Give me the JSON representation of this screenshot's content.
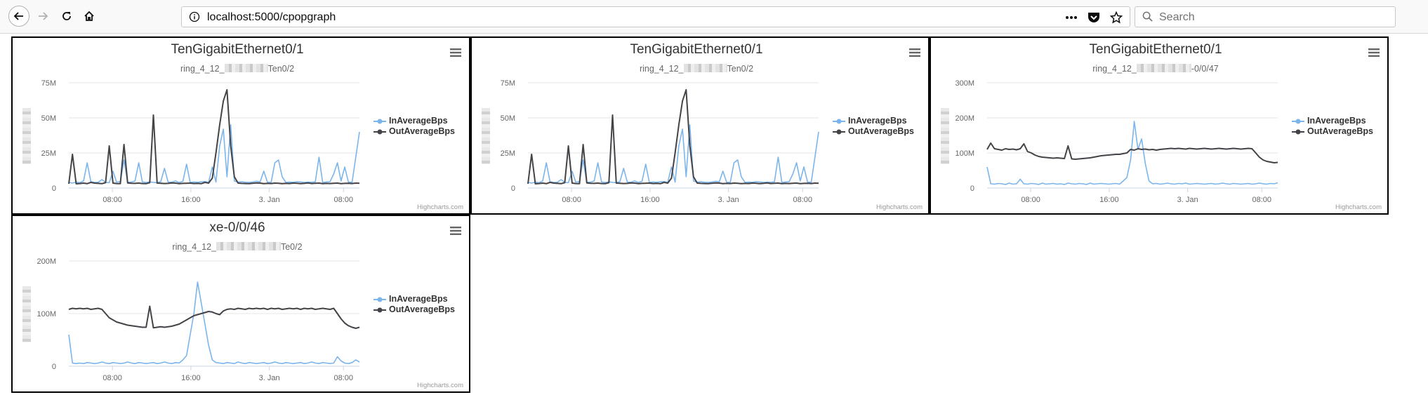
{
  "browser": {
    "url": "localhost:5000/cpopgraph",
    "search_placeholder": "Search"
  },
  "panels": [
    {
      "title": "TenGigabitEthernet0/1",
      "subtitle_left": "ring_4_12_",
      "subtitle_right": "Ten0/2",
      "credits": "Highcharts.com",
      "legend": [
        "InAverageBps",
        "OutAverageBps"
      ]
    },
    {
      "title": "TenGigabitEthernet0/1",
      "subtitle_left": "ring_4_12_",
      "subtitle_right": "Ten0/2",
      "credits": "Highcharts.com",
      "legend": [
        "InAverageBps",
        "OutAverageBps"
      ]
    },
    {
      "title": "TenGigabitEthernet0/1",
      "subtitle_left": "ring_4_12_",
      "subtitle_right": "-0/0/47",
      "credits": "Highcharts.com",
      "legend": [
        "InAverageBps",
        "OutAverageBps"
      ]
    },
    {
      "title": "xe-0/0/46",
      "subtitle_left": "ring_4_12_",
      "subtitle_right": "Te0/2",
      "credits": "Highcharts.com",
      "legend": [
        "InAverageBps",
        "OutAverageBps"
      ]
    }
  ],
  "chart_data": [
    {
      "type": "line",
      "title": "TenGigabitEthernet0/1",
      "subtitle": "ring_4_12_… Ten0/2",
      "x_ticks": [
        "08:00",
        "16:00",
        "3. Jan",
        "08:00"
      ],
      "y_ticks": [
        "0",
        "25M",
        "50M",
        "75M"
      ],
      "ylim": [
        0,
        75000000
      ],
      "legend_position": "right",
      "grid": true,
      "colors": {
        "InAverageBps": "#7cb5ec",
        "OutAverageBps": "#434348"
      },
      "series": [
        {
          "name": "InAverageBps",
          "values": [
            4000000,
            3500000,
            4200000,
            3800000,
            5000000,
            18000000,
            4500000,
            3900000,
            4100000,
            6000000,
            4000000,
            3800000,
            12000000,
            4200000,
            4500000,
            20000000,
            4100000,
            4200000,
            5000000,
            18000000,
            4300000,
            3900000,
            4400000,
            4000000,
            3800000,
            4600000,
            14000000,
            4200000,
            4100000,
            5000000,
            3900000,
            4800000,
            17000000,
            4000000,
            4300000,
            4100000,
            4400000,
            4600000,
            4000000,
            15000000,
            4200000,
            30000000,
            42000000,
            8000000,
            45000000,
            5000000,
            4200000,
            4500000,
            4100000,
            4000000,
            4300000,
            4800000,
            4400000,
            12000000,
            4100000,
            4000000,
            18000000,
            20000000,
            8000000,
            4000000,
            4200000,
            4100000,
            4500000,
            4300000,
            4000000,
            4200000,
            4100000,
            4400000,
            22000000,
            4000000,
            4300000,
            4500000,
            10000000,
            18000000,
            5000000,
            15000000,
            4200000,
            4100000,
            22000000,
            40000000
          ]
        },
        {
          "name": "OutAverageBps",
          "values": [
            3000000,
            24000000,
            3000000,
            3200000,
            3500000,
            3100000,
            4000000,
            3500000,
            3300000,
            3100000,
            3800000,
            30000000,
            3500000,
            3200000,
            3100000,
            31000000,
            3600000,
            3400000,
            3300000,
            3500000,
            3200000,
            3100000,
            3800000,
            52000000,
            3500000,
            3400000,
            3200000,
            3300000,
            3600000,
            3500000,
            3100000,
            3300000,
            3400000,
            3500000,
            3200000,
            3300000,
            3100000,
            4000000,
            3500000,
            7000000,
            25000000,
            45000000,
            62000000,
            70000000,
            30000000,
            8000000,
            3500000,
            3300000,
            3200000,
            3100000,
            3400000,
            3600000,
            3500000,
            3100000,
            3300000,
            3200000,
            3500000,
            3400000,
            3100000,
            3300000,
            3200000,
            3500000,
            3400000,
            3100000,
            3300000,
            3600000,
            3200000,
            3400000,
            3500000,
            3100000,
            3300000,
            3200000,
            3400000,
            3500000,
            3100000,
            3300000,
            3400000,
            3200000,
            3500000,
            3400000
          ]
        }
      ]
    },
    {
      "type": "line",
      "title": "TenGigabitEthernet0/1",
      "subtitle": "ring_4_12_… Ten0/2",
      "x_ticks": [
        "08:00",
        "16:00",
        "3. Jan",
        "08:00"
      ],
      "y_ticks": [
        "0",
        "25M",
        "50M",
        "75M"
      ],
      "ylim": [
        0,
        75000000
      ],
      "legend_position": "right",
      "grid": true,
      "colors": {
        "InAverageBps": "#7cb5ec",
        "OutAverageBps": "#434348"
      },
      "series": [
        {
          "name": "InAverageBps",
          "values": [
            4000000,
            3500000,
            4200000,
            3800000,
            5000000,
            18000000,
            4500000,
            3900000,
            4100000,
            6000000,
            4000000,
            3800000,
            12000000,
            4200000,
            4500000,
            20000000,
            4100000,
            4200000,
            5000000,
            18000000,
            4300000,
            3900000,
            4400000,
            4000000,
            3800000,
            4600000,
            14000000,
            4200000,
            4100000,
            5000000,
            3900000,
            4800000,
            17000000,
            4000000,
            4300000,
            4100000,
            4400000,
            4600000,
            4000000,
            15000000,
            4200000,
            30000000,
            42000000,
            8000000,
            45000000,
            5000000,
            4200000,
            4500000,
            4100000,
            4000000,
            4300000,
            4800000,
            4400000,
            12000000,
            4100000,
            4000000,
            18000000,
            20000000,
            8000000,
            4000000,
            4200000,
            4100000,
            4500000,
            4300000,
            4000000,
            4200000,
            4100000,
            4400000,
            22000000,
            4000000,
            4300000,
            4500000,
            10000000,
            18000000,
            5000000,
            15000000,
            4200000,
            4100000,
            22000000,
            40000000
          ]
        },
        {
          "name": "OutAverageBps",
          "values": [
            3000000,
            24000000,
            3000000,
            3200000,
            3500000,
            3100000,
            4000000,
            3500000,
            3300000,
            3100000,
            3800000,
            30000000,
            3500000,
            3200000,
            3100000,
            31000000,
            3600000,
            3400000,
            3300000,
            3500000,
            3200000,
            3100000,
            3800000,
            52000000,
            3500000,
            3400000,
            3200000,
            3300000,
            3600000,
            3500000,
            3100000,
            3300000,
            3400000,
            3500000,
            3200000,
            3300000,
            3100000,
            4000000,
            3500000,
            7000000,
            25000000,
            45000000,
            62000000,
            70000000,
            30000000,
            8000000,
            3500000,
            3300000,
            3200000,
            3100000,
            3400000,
            3600000,
            3500000,
            3100000,
            3300000,
            3200000,
            3500000,
            3400000,
            3100000,
            3300000,
            3200000,
            3500000,
            3400000,
            3100000,
            3300000,
            3600000,
            3200000,
            3400000,
            3500000,
            3100000,
            3300000,
            3200000,
            3400000,
            3500000,
            3100000,
            3300000,
            3400000,
            3200000,
            3500000,
            3400000
          ]
        }
      ]
    },
    {
      "type": "line",
      "title": "TenGigabitEthernet0/1",
      "subtitle": "ring_4_12_… -0/0/47",
      "x_ticks": [
        "08:00",
        "16:00",
        "3. Jan",
        "08:00"
      ],
      "y_ticks": [
        "0",
        "100M",
        "200M",
        "300M"
      ],
      "ylim": [
        0,
        300000000
      ],
      "legend_position": "right",
      "grid": true,
      "colors": {
        "InAverageBps": "#7cb5ec",
        "OutAverageBps": "#434348"
      },
      "series": [
        {
          "name": "InAverageBps",
          "values": [
            60000000,
            12000000,
            11000000,
            13000000,
            12000000,
            10000000,
            14000000,
            11000000,
            12000000,
            25000000,
            12000000,
            11000000,
            13000000,
            12000000,
            10000000,
            14000000,
            11000000,
            12000000,
            13000000,
            11000000,
            12000000,
            10000000,
            14000000,
            12000000,
            11000000,
            13000000,
            12000000,
            10000000,
            14000000,
            11000000,
            12000000,
            13000000,
            12000000,
            11000000,
            12000000,
            13000000,
            11000000,
            20000000,
            30000000,
            80000000,
            190000000,
            110000000,
            140000000,
            70000000,
            20000000,
            12000000,
            13000000,
            11000000,
            12000000,
            14000000,
            12000000,
            11000000,
            13000000,
            12000000,
            14000000,
            11000000,
            12000000,
            13000000,
            12000000,
            11000000,
            12000000,
            13000000,
            11000000,
            12000000,
            14000000,
            12000000,
            11000000,
            13000000,
            12000000,
            11000000,
            12000000,
            13000000,
            11000000,
            12000000,
            14000000,
            12000000,
            11000000,
            13000000,
            12000000,
            15000000
          ]
        },
        {
          "name": "OutAverageBps",
          "values": [
            110000000,
            128000000,
            112000000,
            110000000,
            108000000,
            112000000,
            110000000,
            111000000,
            109000000,
            112000000,
            126000000,
            104000000,
            100000000,
            94000000,
            90000000,
            88000000,
            87000000,
            86000000,
            85000000,
            86000000,
            85000000,
            84000000,
            120000000,
            83000000,
            82000000,
            83000000,
            84000000,
            85000000,
            86000000,
            88000000,
            90000000,
            92000000,
            93000000,
            94000000,
            95000000,
            96000000,
            96000000,
            98000000,
            100000000,
            110000000,
            108000000,
            112000000,
            110000000,
            111000000,
            109000000,
            110000000,
            108000000,
            110000000,
            111000000,
            112000000,
            113000000,
            112000000,
            113000000,
            112000000,
            111000000,
            113000000,
            112000000,
            111000000,
            112000000,
            113000000,
            112000000,
            111000000,
            112000000,
            113000000,
            112000000,
            111000000,
            112000000,
            113000000,
            112000000,
            111000000,
            112000000,
            113000000,
            112000000,
            100000000,
            88000000,
            80000000,
            76000000,
            74000000,
            72000000,
            73000000
          ]
        }
      ]
    },
    {
      "type": "line",
      "title": "xe-0/0/46",
      "subtitle": "ring_4_12_… Te0/2",
      "x_ticks": [
        "08:00",
        "16:00",
        "3. Jan",
        "08:00"
      ],
      "y_ticks": [
        "0",
        "100M",
        "200M"
      ],
      "ylim": [
        0,
        200000000
      ],
      "legend_position": "right",
      "grid": true,
      "colors": {
        "InAverageBps": "#7cb5ec",
        "OutAverageBps": "#434348"
      },
      "series": [
        {
          "name": "InAverageBps",
          "values": [
            60000000,
            6000000,
            5000000,
            6000000,
            5000000,
            7000000,
            6000000,
            5000000,
            6000000,
            8000000,
            6000000,
            5000000,
            7000000,
            6000000,
            5000000,
            6000000,
            8000000,
            6000000,
            5000000,
            7000000,
            6000000,
            5000000,
            6000000,
            7000000,
            5000000,
            6000000,
            8000000,
            6000000,
            5000000,
            7000000,
            6000000,
            12000000,
            20000000,
            60000000,
            100000000,
            160000000,
            120000000,
            80000000,
            40000000,
            12000000,
            7000000,
            6000000,
            5000000,
            7000000,
            6000000,
            5000000,
            8000000,
            6000000,
            5000000,
            7000000,
            6000000,
            5000000,
            6000000,
            7000000,
            5000000,
            6000000,
            8000000,
            6000000,
            5000000,
            7000000,
            6000000,
            5000000,
            6000000,
            7000000,
            5000000,
            6000000,
            8000000,
            6000000,
            5000000,
            7000000,
            6000000,
            5000000,
            6000000,
            18000000,
            10000000,
            6000000,
            5000000,
            7000000,
            12000000,
            8000000
          ]
        },
        {
          "name": "OutAverageBps",
          "values": [
            108000000,
            110000000,
            109000000,
            110000000,
            109000000,
            110000000,
            108000000,
            109000000,
            110000000,
            108000000,
            100000000,
            92000000,
            88000000,
            84000000,
            82000000,
            80000000,
            78000000,
            77000000,
            76000000,
            75000000,
            74000000,
            74000000,
            114000000,
            73000000,
            74000000,
            75000000,
            74000000,
            75000000,
            76000000,
            78000000,
            80000000,
            84000000,
            88000000,
            92000000,
            96000000,
            98000000,
            100000000,
            102000000,
            104000000,
            103000000,
            100000000,
            98000000,
            105000000,
            108000000,
            109000000,
            108000000,
            110000000,
            109000000,
            108000000,
            110000000,
            109000000,
            110000000,
            109000000,
            110000000,
            108000000,
            110000000,
            109000000,
            110000000,
            108000000,
            109000000,
            110000000,
            109000000,
            110000000,
            108000000,
            110000000,
            109000000,
            110000000,
            108000000,
            109000000,
            110000000,
            109000000,
            108000000,
            110000000,
            100000000,
            90000000,
            82000000,
            77000000,
            74000000,
            72000000,
            74000000
          ]
        }
      ]
    }
  ]
}
